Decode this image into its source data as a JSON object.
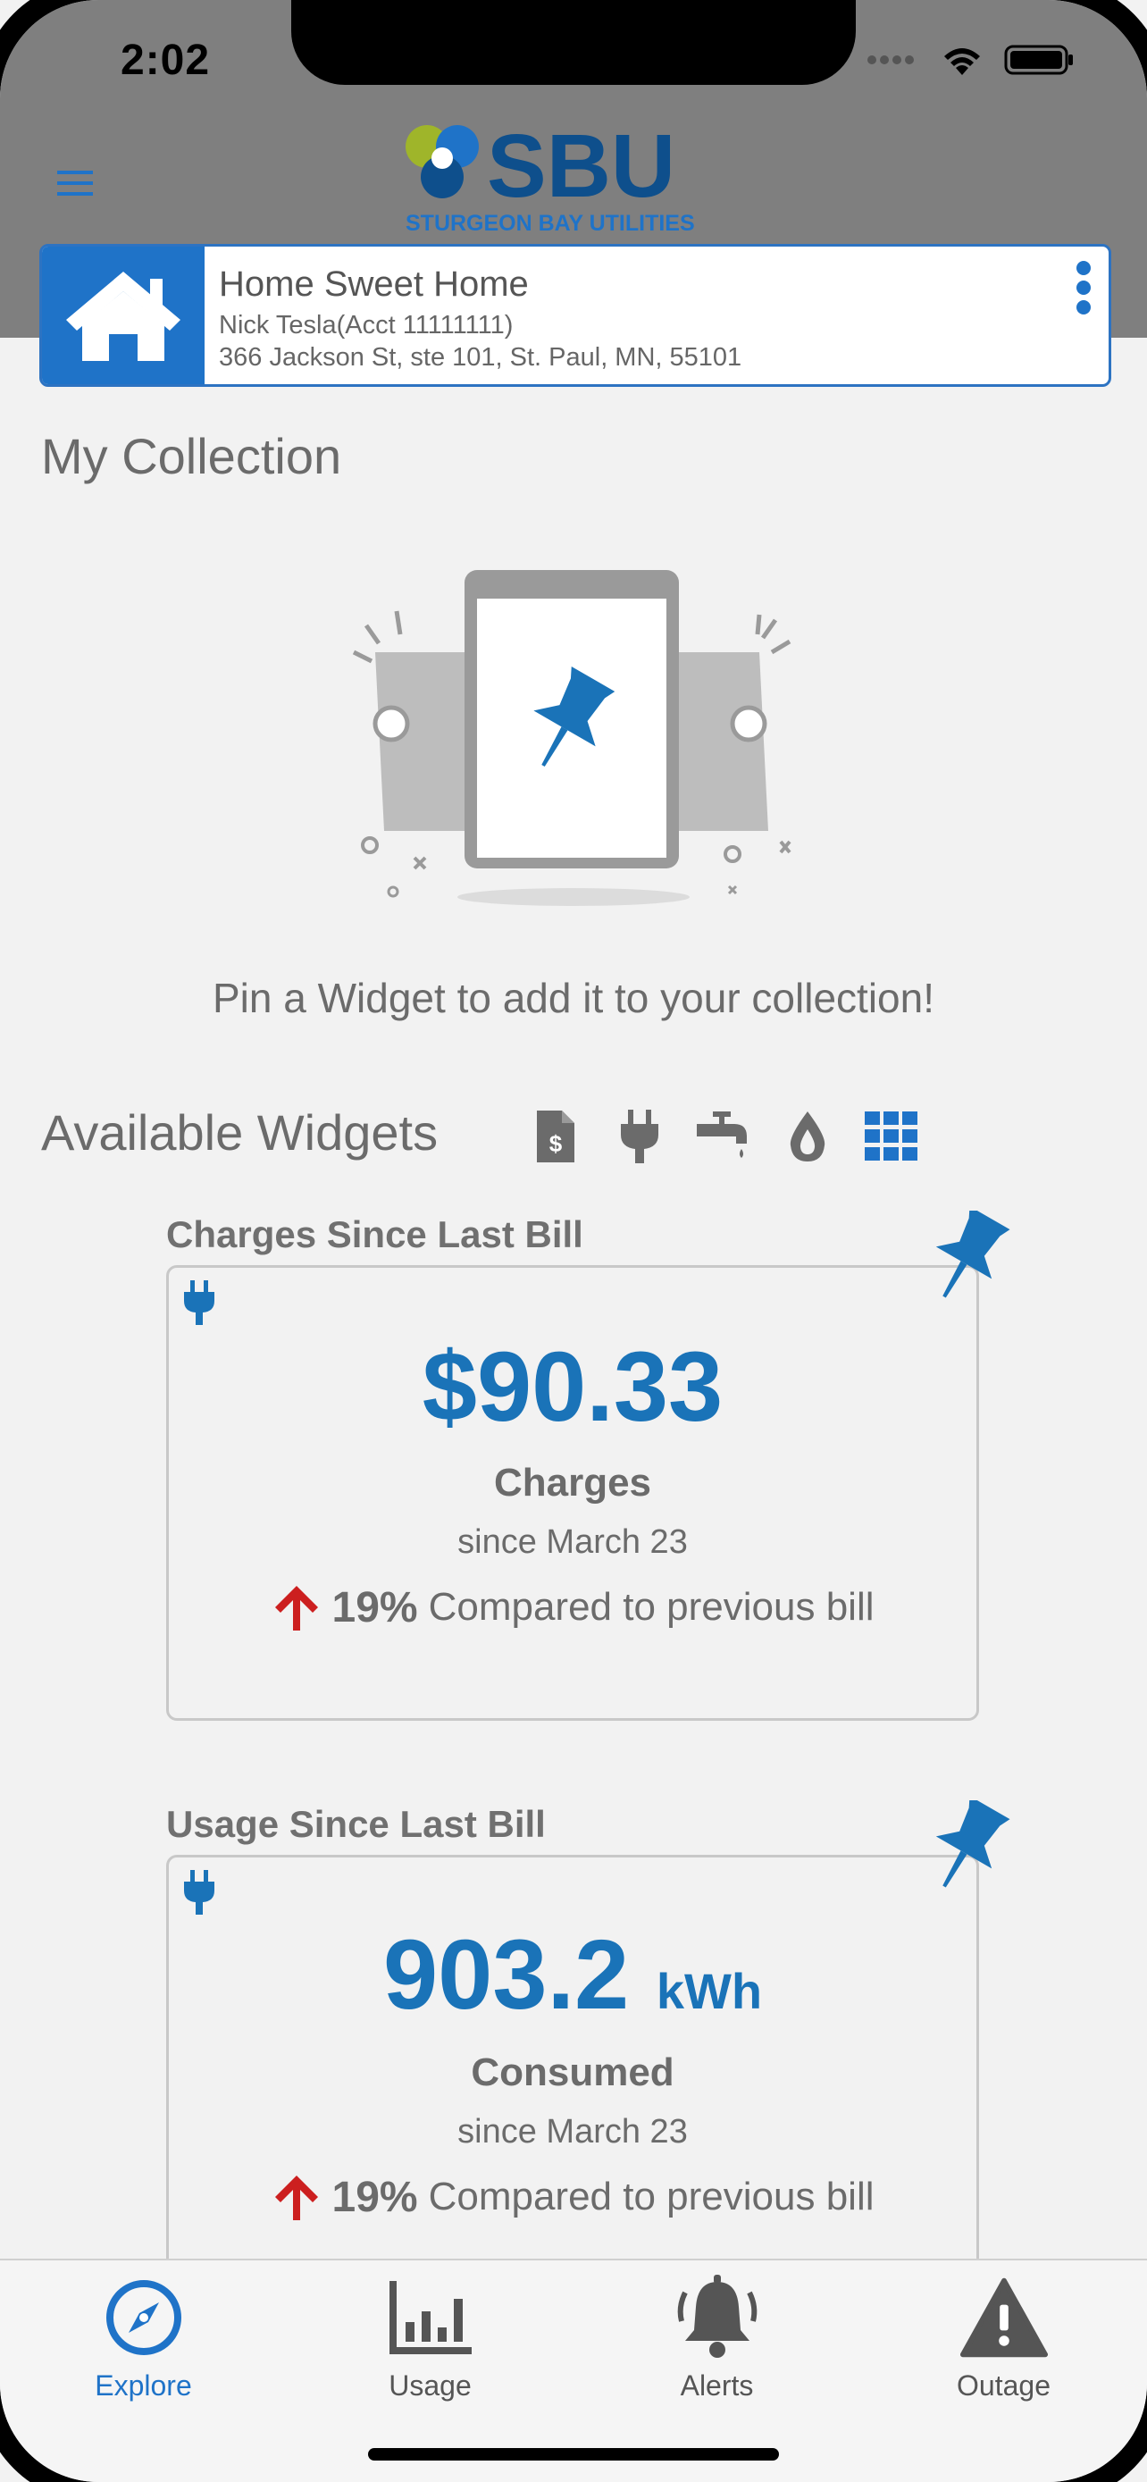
{
  "status_bar": {
    "time": "2:02"
  },
  "brand": {
    "name": "SBU",
    "tagline": "STURGEON BAY UTILITIES"
  },
  "account": {
    "name": "Home Sweet Home",
    "holder": "Nick Tesla(Acct 11111111)",
    "address": "366 Jackson St, ste 101, St. Paul, MN, 55101"
  },
  "collection": {
    "title": "My Collection",
    "empty_message": "Pin a Widget to add it to your collection!"
  },
  "available": {
    "title": "Available Widgets",
    "filters": [
      "bill-icon",
      "plug-icon",
      "faucet-icon",
      "drop-icon",
      "grid-icon"
    ],
    "active_filter": "grid-icon"
  },
  "widgets": [
    {
      "title": "Charges Since Last Bill",
      "value": "$90.33",
      "unit": "",
      "label": "Charges",
      "since": "since March 23",
      "percent": "19%",
      "compare": "Compared to previous bill"
    },
    {
      "title": "Usage Since Last Bill",
      "value": "903.2",
      "unit": "kWh",
      "label": "Consumed",
      "since": "since March 23",
      "percent": "19%",
      "compare": "Compared to previous bill"
    }
  ],
  "tabs": [
    {
      "label": "Explore",
      "icon": "compass-icon",
      "active": true
    },
    {
      "label": "Usage",
      "icon": "bar-chart-icon",
      "active": false
    },
    {
      "label": "Alerts",
      "icon": "bell-icon",
      "active": false
    },
    {
      "label": "Outage",
      "icon": "warning-icon",
      "active": false
    }
  ],
  "colors": {
    "accent": "#1f73c8",
    "value_blue": "#1a73b8",
    "up_arrow": "#cc1f1f",
    "header_gray": "#7f7f7f"
  }
}
